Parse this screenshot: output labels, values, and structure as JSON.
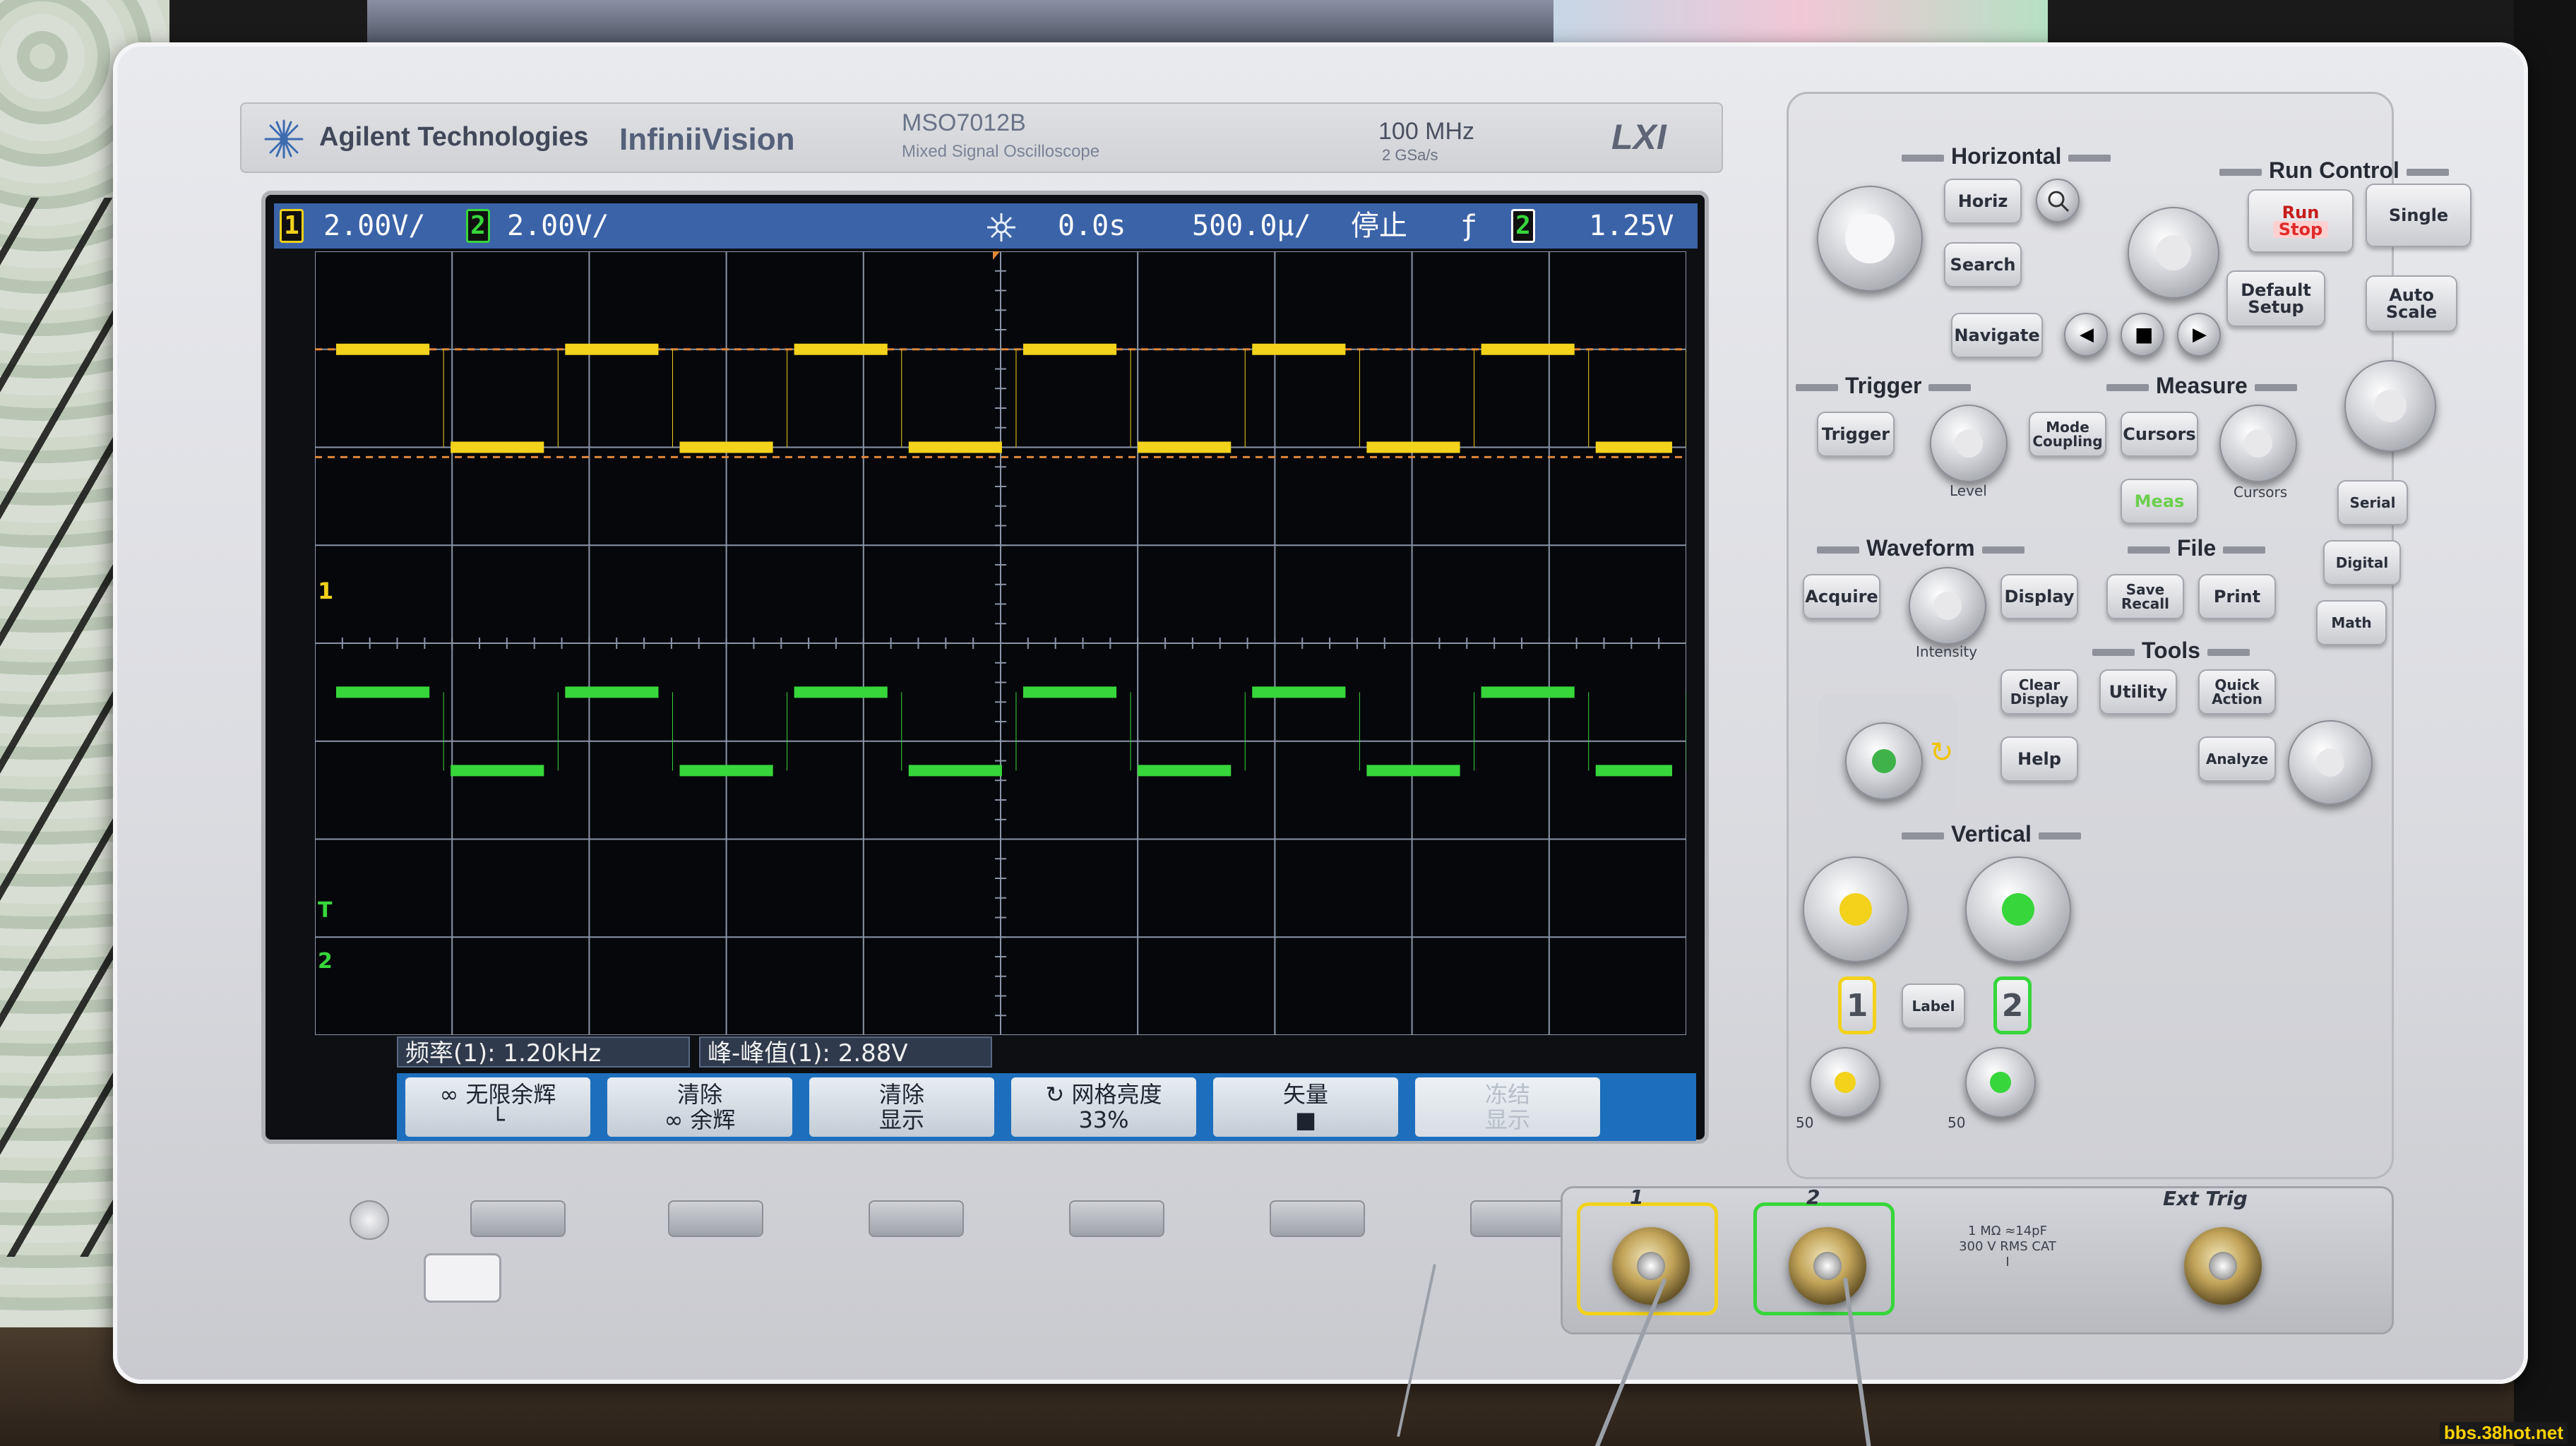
{
  "brand": {
    "company": "Agilent Technologies",
    "series": "InfiniiVision",
    "model": "MSO7012B",
    "model_sub": "Mixed Signal Oscilloscope",
    "bandwidth": "100 MHz",
    "sample_rate": "2 GSa/s",
    "lxi": "LXI"
  },
  "display": {
    "ch1_num": "1",
    "ch1_scale": "2.00V/",
    "ch2_num": "2",
    "ch2_scale": "2.00V/",
    "time_pos": "0.0s",
    "time_scale": "500.0µ/",
    "run_state": "停止",
    "trigger_slope": "ƒ",
    "trigger_ch": "2",
    "trigger_level": "1.25V",
    "marker_ch1": "1",
    "marker_trig": "T",
    "marker_ch2": "2"
  },
  "colors": {
    "ch1": "#f2d21b",
    "ch2": "#37d63b",
    "grid": "#8a95a8",
    "ref_line": "#e0873a",
    "status_bar": "#3b63a8",
    "softkey_bar": "#1d6fbd"
  },
  "measurements": {
    "freq": "频率(1): 1.20kHz",
    "vpp": "峰-峰值(1): 2.88V"
  },
  "softkeys": [
    {
      "line1": "∞ 无限余辉",
      "line2": "└"
    },
    {
      "line1": "清除",
      "line2": "∞ 余辉"
    },
    {
      "line1": "清除",
      "line2": "显示"
    },
    {
      "line1": "↻ 网格亮度",
      "line2": "33%"
    },
    {
      "line1": "矢量",
      "line2": "■"
    },
    {
      "line1": "冻结",
      "line2": "显示"
    }
  ],
  "waveforms": {
    "ch1": {
      "high_div": 1.0,
      "low_div": 2.0,
      "period_div": 1.67
    },
    "ch2": {
      "high_div": 4.5,
      "low_div": 5.3,
      "period_div": 1.67
    },
    "ref_lines_div": [
      1.0,
      2.1
    ]
  },
  "panel": {
    "horizontal": "Horizontal",
    "horiz_btn": "Horiz",
    "search_btn": "Search",
    "navigate_btn": "Navigate",
    "run_control": "Run Control",
    "run_btn": "Run",
    "stop_btn": "Stop",
    "single_btn": "Single",
    "default_setup_1": "Default",
    "default_setup_2": "Setup",
    "auto_scale_1": "Auto",
    "auto_scale_2": "Scale",
    "trigger": "Trigger",
    "trigger_btn": "Trigger",
    "mode_1": "Mode",
    "mode_2": "Coupling",
    "level": "Level",
    "measure": "Measure",
    "cursors_btn": "Cursors",
    "meas_btn": "Meas",
    "cursors_knob": "Cursors",
    "waveform": "Waveform",
    "acquire_btn": "Acquire",
    "display_btn": "Display",
    "intensity": "Intensity",
    "file": "File",
    "save_1": "Save",
    "save_2": "Recall",
    "print_btn": "Print",
    "tools": "Tools",
    "clear_1": "Clear",
    "clear_2": "Display",
    "utility_btn": "Utility",
    "quick_1": "Quick",
    "quick_2": "Action",
    "help_btn": "Help",
    "analyze_btn": "Analyze",
    "serial_btn": "Serial",
    "digital_btn": "Digital",
    "math_btn": "Math",
    "vertical": "Vertical",
    "ch1_label": "1",
    "ch2_label": "2",
    "label_btn": "Label",
    "ext_trig": "Ext Trig",
    "ohm_50_1": "50",
    "ohm_50_2": "50",
    "conn_ch1": "1",
    "conn_ch2": "2",
    "input_spec": "1 MΩ ≈14pF 300 V RMS CAT I"
  },
  "watermark": "bbs.38hot.net"
}
